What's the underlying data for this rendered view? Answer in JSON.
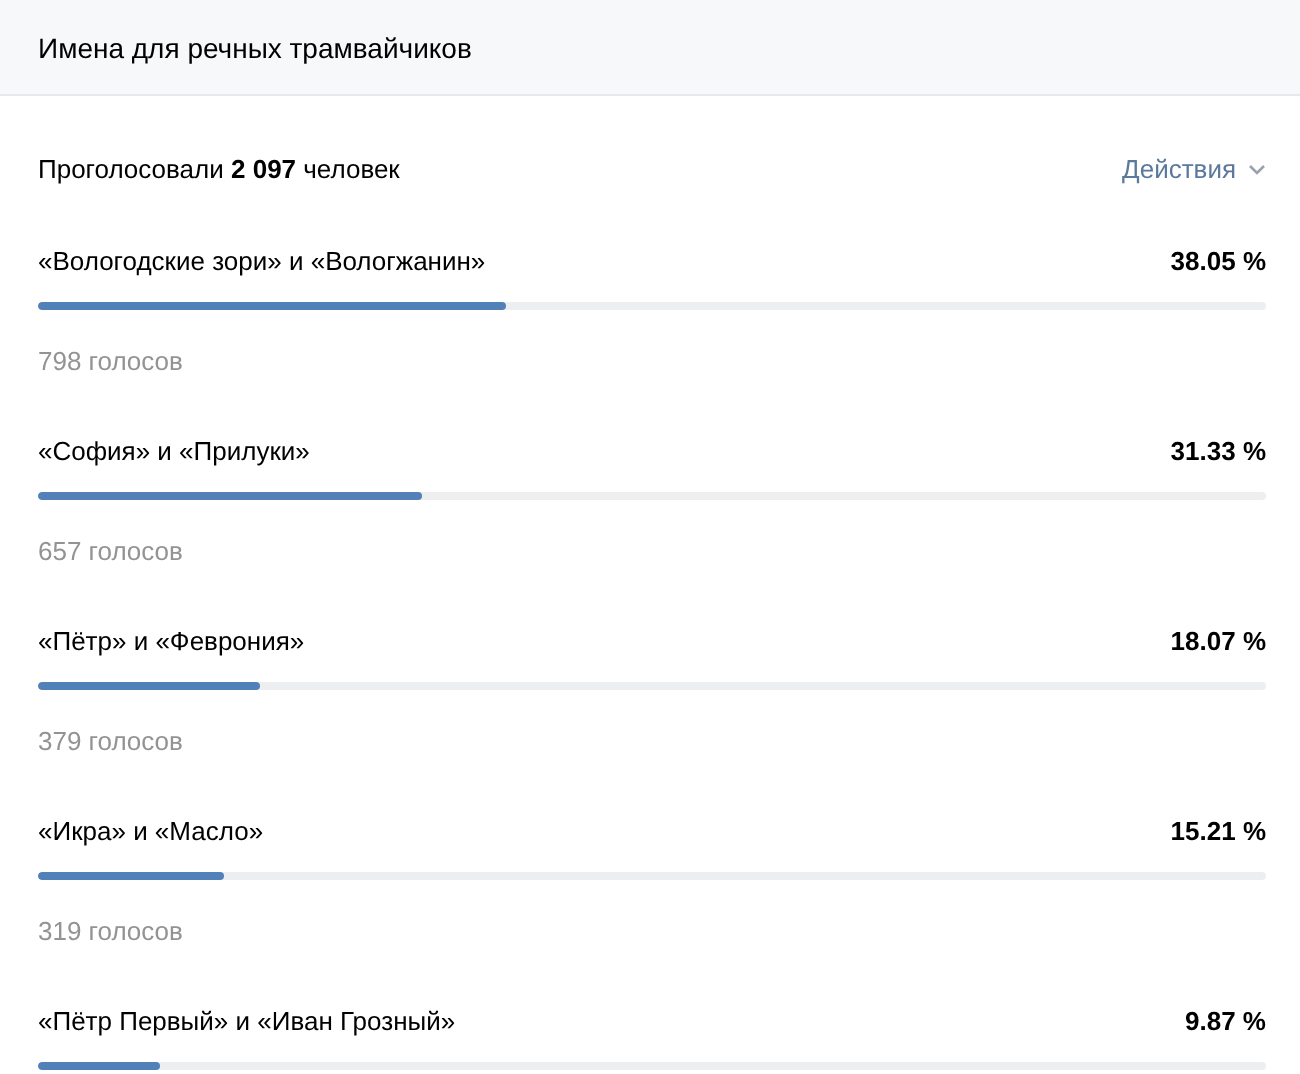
{
  "header": {
    "title": "Имена для речных трамвайчиков"
  },
  "summary": {
    "text": "Проголосовали **2 097** человек",
    "actions": "Действия"
  },
  "options": [
    {
      "label": "«Вологодские зори» и «Вологжанин»",
      "percent": "38.05 %",
      "level": 0.3805,
      "votes": "798 голосов"
    },
    {
      "label": "«София» и «Прилуки»",
      "percent": "31.33 %",
      "level": 0.3133,
      "votes": "657 голосов"
    },
    {
      "label": "«Пётр» и «Феврония»",
      "percent": "18.07 %",
      "level": 0.1807,
      "votes": "379 голосов"
    },
    {
      "label": "«Икра» и «Масло»",
      "percent": "15.21 %",
      "level": 0.1521,
      "votes": "319 голосов"
    },
    {
      "label": "«Пётр Первый» и «Иван Грозный»",
      "percent": "9.87 %",
      "level": 0.0987
    }
  ]
}
